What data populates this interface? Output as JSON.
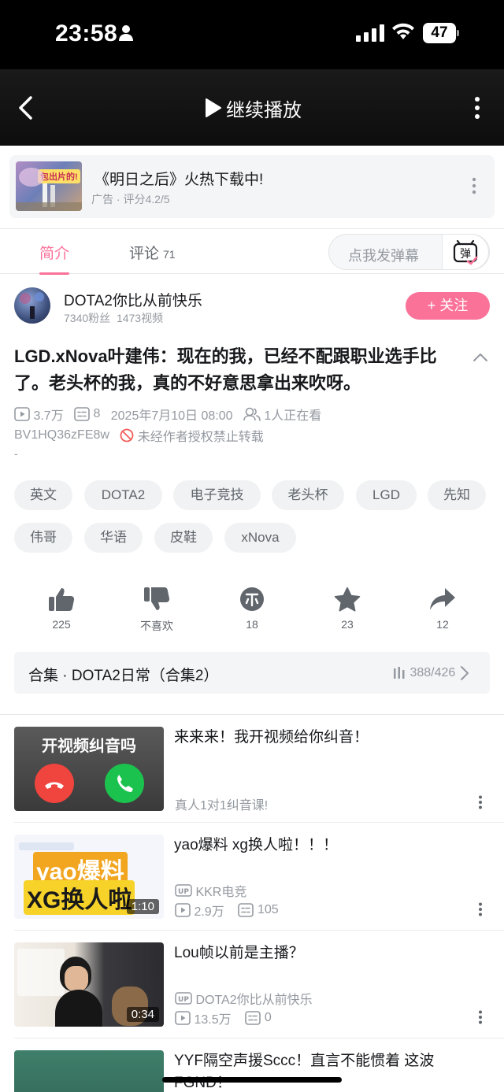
{
  "status_bar": {
    "time": "23:58",
    "battery": "47"
  },
  "nav": {
    "title": "继续播放"
  },
  "ad": {
    "title": "《明日之后》火热下载中!",
    "meta": "广告 · 评分4.2/5",
    "thumb_badge": "包出片的!"
  },
  "tabs": {
    "intro": "简介",
    "comments": "评论",
    "comments_count": "71",
    "danmaku_placeholder": "点我发弹幕"
  },
  "uploader": {
    "name": "DOTA2你比从前快乐",
    "fans": "7340粉丝",
    "videos": "1473视频",
    "follow_label": "+ 关注"
  },
  "video": {
    "title": "LGD.xNova叶建伟：现在的我，已经不配跟职业选手比了。老头杯的我，真的不好意思拿出来吹呀。",
    "views": "3.7万",
    "danmaku_count": "8",
    "date": "2025年7月10日 08:00",
    "watching": "1人正在看",
    "bvid": "BV1HQ36zFE8w",
    "copyright": "未经作者授权禁止转载",
    "dash": "-"
  },
  "tags": [
    "英文",
    "DOTA2",
    "电子竞技",
    "老头杯",
    "LGD",
    "先知",
    "伟哥",
    "华语",
    "皮鞋",
    "xNova"
  ],
  "actions": {
    "like": "225",
    "dislike": "不喜欢",
    "coin": "18",
    "favorite": "23",
    "share": "12"
  },
  "collection": {
    "title": "合集 · DOTA2日常（合集2）",
    "progress": "388/426"
  },
  "recommendations": [
    {
      "title": "来来来！我开视频给你纠音！",
      "sub": "真人1对1纠音课!",
      "thumb_text": "开视频纠音吗"
    },
    {
      "title": "yao爆料 xg换人啦！！！",
      "uploader": "KKR电竞",
      "views": "2.9万",
      "danmaku": "105",
      "duration": "1:10",
      "thumb_text_1": "yao爆料",
      "thumb_text_2": "XG换人啦"
    },
    {
      "title": "Lou帧以前是主播？",
      "uploader": "DOTA2你比从前快乐",
      "views": "13.5万",
      "danmaku": "0",
      "duration": "0:34"
    },
    {
      "title": "YYF隔空声援Sccc！直言不能惯着 这波FGND！"
    }
  ],
  "colors": {
    "accent": "#fb7299",
    "text": "#18191c",
    "muted": "#9499a0"
  }
}
